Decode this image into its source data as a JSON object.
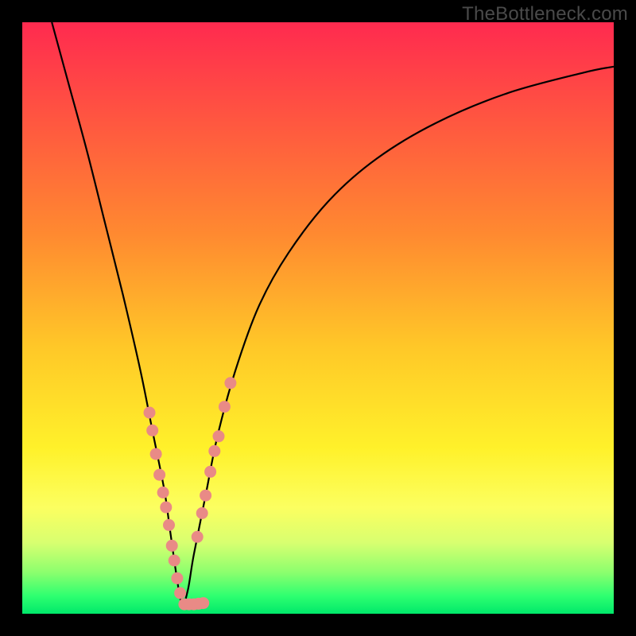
{
  "watermark": "TheBottleneck.com",
  "colors": {
    "frame": "#000000",
    "gradient_top": "#ff2a4f",
    "gradient_bottom": "#00e86a",
    "curve": "#000000",
    "dots": "#e98a86"
  },
  "chart_data": {
    "type": "line",
    "title": "",
    "xlabel": "",
    "ylabel": "",
    "xlim": [
      0,
      100
    ],
    "ylim": [
      0,
      100
    ],
    "vertex_x": 27,
    "series": [
      {
        "name": "bottleneck-curve",
        "x": [
          5,
          8,
          11,
          14,
          17,
          20,
          22,
          24,
          25,
          26,
          27,
          28,
          29,
          31,
          33,
          36,
          40,
          45,
          52,
          60,
          70,
          82,
          95,
          100
        ],
        "values": [
          100,
          89,
          78,
          66,
          54,
          41,
          31,
          21,
          14,
          7,
          1.5,
          4,
          10,
          20,
          30,
          41,
          52,
          61,
          70,
          77,
          83,
          88,
          91.5,
          92.5
        ]
      }
    ],
    "scatter": [
      {
        "x": 21.5,
        "y": 34
      },
      {
        "x": 22.0,
        "y": 31
      },
      {
        "x": 22.6,
        "y": 27
      },
      {
        "x": 23.2,
        "y": 23.5
      },
      {
        "x": 23.8,
        "y": 20.5
      },
      {
        "x": 24.3,
        "y": 18
      },
      {
        "x": 24.8,
        "y": 15
      },
      {
        "x": 25.3,
        "y": 11.5
      },
      {
        "x": 25.7,
        "y": 9
      },
      {
        "x": 26.2,
        "y": 6
      },
      {
        "x": 26.7,
        "y": 3.5
      },
      {
        "x": 27.4,
        "y": 1.6
      },
      {
        "x": 28.2,
        "y": 1.6
      },
      {
        "x": 29.0,
        "y": 1.6
      },
      {
        "x": 29.8,
        "y": 1.7
      },
      {
        "x": 30.6,
        "y": 1.8
      },
      {
        "x": 29.6,
        "y": 13
      },
      {
        "x": 30.4,
        "y": 17
      },
      {
        "x": 31.0,
        "y": 20
      },
      {
        "x": 31.8,
        "y": 24
      },
      {
        "x": 32.5,
        "y": 27.5
      },
      {
        "x": 33.2,
        "y": 30
      },
      {
        "x": 34.2,
        "y": 35
      },
      {
        "x": 35.2,
        "y": 39
      }
    ]
  }
}
